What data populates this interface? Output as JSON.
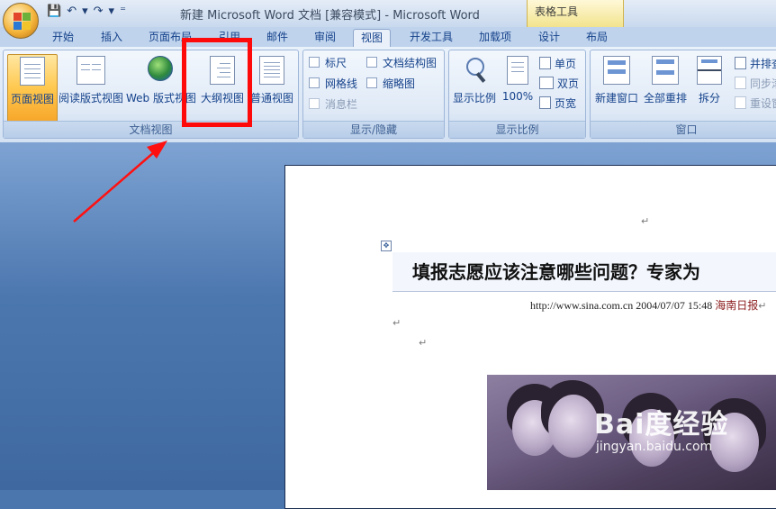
{
  "window": {
    "title": "新建 Microsoft Word 文档 [兼容模式] - Microsoft Word",
    "context_tab_group": "表格工具"
  },
  "tabs": [
    "开始",
    "插入",
    "页面布局",
    "引用",
    "邮件",
    "审阅",
    "视图",
    "开发工具",
    "加载项",
    "设计",
    "布局"
  ],
  "active_tab": "视图",
  "ribbon": {
    "doc_views": {
      "label": "文档视图",
      "buttons": [
        "页面视图",
        "阅读版式视图",
        "Web 版式视图",
        "大纲视图",
        "普通视图"
      ],
      "active": "页面视图"
    },
    "show_hide": {
      "label": "显示/隐藏",
      "checkboxes": [
        {
          "label": "标尺",
          "checked": false,
          "enabled": true
        },
        {
          "label": "文档结构图",
          "checked": false,
          "enabled": true
        },
        {
          "label": "网格线",
          "checked": false,
          "enabled": true
        },
        {
          "label": "缩略图",
          "checked": false,
          "enabled": true
        },
        {
          "label": "消息栏",
          "checked": false,
          "enabled": false
        }
      ]
    },
    "zoom": {
      "label": "显示比例",
      "zoom_button": "显示比例",
      "hundred_button": "100%",
      "one_page": "单页",
      "two_pages": "双页",
      "page_width": "页宽"
    },
    "window": {
      "label": "窗口",
      "new_window": "新建窗口",
      "arrange_all": "全部重排",
      "split": "拆分",
      "side_by_side": "并排查",
      "sync_scroll": "同步滚",
      "reset_position": "重设窗"
    }
  },
  "document": {
    "title": "填报志愿应该注意哪些问题？专家为",
    "meta_text": "http://www.sina.com.cn 2004/07/07 15:48",
    "meta_source": "海南日报",
    "para_mark": "↵",
    "move_handle": "✥"
  },
  "watermark": {
    "brand": "Bai度经验",
    "url": "jingyan.baidu.com"
  },
  "colors": {
    "annotation_red": "#ff0a0a",
    "active_button": "#ffc84e"
  }
}
